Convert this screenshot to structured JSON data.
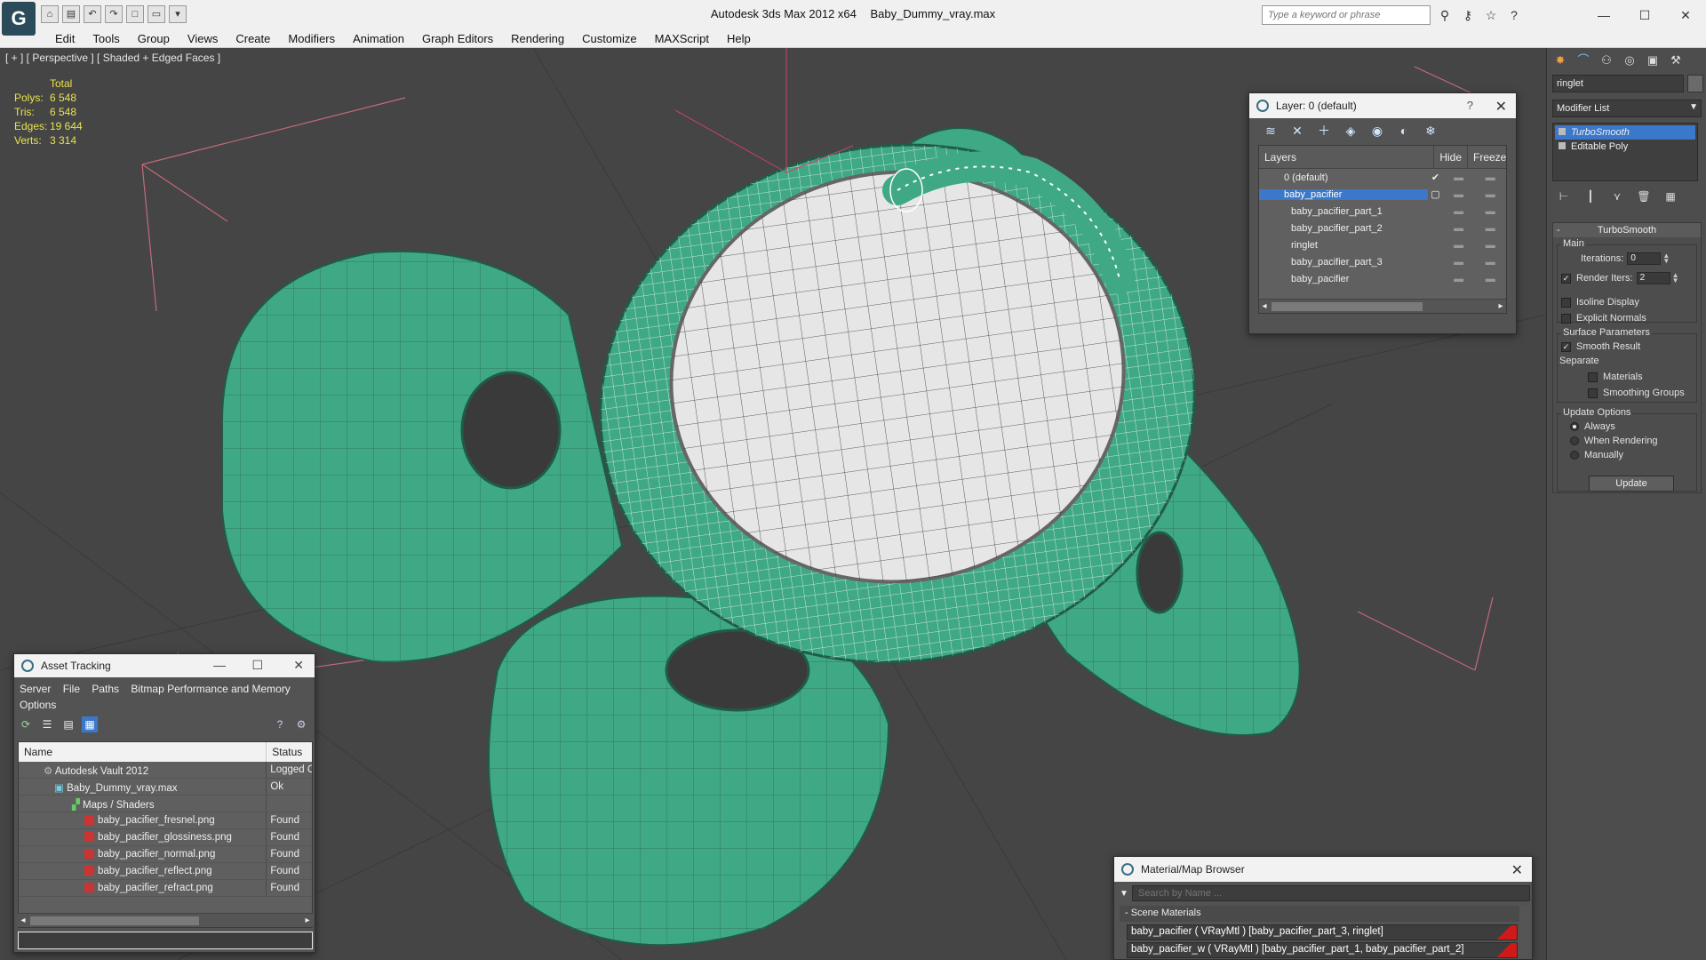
{
  "titlebar": {
    "app_name": "Autodesk 3ds Max  2012 x64",
    "file_name": "Baby_Dummy_vray.max",
    "search_placeholder": "Type a keyword or phrase",
    "logo_letter": "G"
  },
  "menu": [
    "Edit",
    "Tools",
    "Group",
    "Views",
    "Create",
    "Modifiers",
    "Animation",
    "Graph Editors",
    "Rendering",
    "Customize",
    "MAXScript",
    "Help"
  ],
  "viewport": {
    "label": "[ + ] [ Perspective ] [ Shaded + Edged Faces ]",
    "stats_header": "Total",
    "stats": [
      {
        "key": "Polys:",
        "value": "6 548"
      },
      {
        "key": "Tris:",
        "value": "6 548"
      },
      {
        "key": "Edges:",
        "value": "19 644"
      },
      {
        "key": "Verts:",
        "value": "3 314"
      }
    ]
  },
  "layer_panel": {
    "title": "Layer: 0 (default)",
    "help": "?",
    "columns": {
      "name": "Layers",
      "hide": "Hide",
      "freeze": "Freeze"
    },
    "rows": [
      {
        "name": "0 (default)",
        "level": 0,
        "selected": false,
        "check": "✔"
      },
      {
        "name": "baby_pacifier",
        "level": 0,
        "selected": true,
        "check": "▢"
      },
      {
        "name": "baby_pacifier_part_1",
        "level": 1,
        "selected": false,
        "check": ""
      },
      {
        "name": "baby_pacifier_part_2",
        "level": 1,
        "selected": false,
        "check": ""
      },
      {
        "name": "ringlet",
        "level": 1,
        "selected": false,
        "check": ""
      },
      {
        "name": "baby_pacifier_part_3",
        "level": 1,
        "selected": false,
        "check": ""
      },
      {
        "name": "baby_pacifier",
        "level": 1,
        "selected": false,
        "check": ""
      }
    ]
  },
  "command_panel": {
    "object_name": "ringlet",
    "modifier_list": "Modifier List",
    "stack": [
      {
        "name": "TurboSmooth",
        "selected": true
      },
      {
        "name": "Editable Poly",
        "selected": false
      }
    ],
    "rollout_title": "TurboSmooth",
    "main_label": "Main",
    "iterations_label": "Iterations:",
    "iterations_value": "0",
    "render_iters_label": "Render Iters:",
    "render_iters_value": "2",
    "isoline_label": "Isoline Display",
    "explicit_normals_label": "Explicit Normals",
    "surface_params_label": "Surface Parameters",
    "smooth_result_label": "Smooth Result",
    "separate_label": "Separate",
    "materials_label": "Materials",
    "smoothing_groups_label": "Smoothing Groups",
    "update_options_label": "Update Options",
    "always_label": "Always",
    "when_rendering_label": "When Rendering",
    "manually_label": "Manually",
    "update_button": "Update"
  },
  "asset_tracking": {
    "title": "Asset Tracking",
    "menu": [
      "Server",
      "File",
      "Paths",
      "Bitmap Performance and Memory"
    ],
    "menu2": "Options",
    "columns": {
      "name": "Name",
      "status": "Status"
    },
    "rows": [
      {
        "name": "Autodesk Vault 2012",
        "status": "Logged Out",
        "indent": 1,
        "icon": "vault"
      },
      {
        "name": "Baby_Dummy_vray.max",
        "status": "Ok",
        "indent": 2,
        "icon": "max"
      },
      {
        "name": "Maps / Shaders",
        "status": "",
        "indent": 3,
        "icon": "folder"
      },
      {
        "name": "baby_pacifier_fresnel.png",
        "status": "Found",
        "indent": 4,
        "icon": "png"
      },
      {
        "name": "baby_pacifier_glossiness.png",
        "status": "Found",
        "indent": 4,
        "icon": "png"
      },
      {
        "name": "baby_pacifier_normal.png",
        "status": "Found",
        "indent": 4,
        "icon": "png"
      },
      {
        "name": "baby_pacifier_reflect.png",
        "status": "Found",
        "indent": 4,
        "icon": "png"
      },
      {
        "name": "baby_pacifier_refract.png",
        "status": "Found",
        "indent": 4,
        "icon": "png"
      }
    ]
  },
  "material_browser": {
    "title": "Material/Map Browser",
    "search_placeholder": "Search by Name ...",
    "group": "- Scene Materials",
    "rows": [
      "baby_pacifier  ( VRayMtl ) [baby_pacifier_part_3, ringlet]",
      "baby_pacifier_w  ( VRayMtl ) [baby_pacifier_part_1, baby_pacifier_part_2]"
    ]
  },
  "colors": {
    "mesh_green": "#3fa884",
    "viewport_bg": "#454545",
    "selection": "#3b78c9",
    "stats_yellow": "#e9e24e"
  }
}
